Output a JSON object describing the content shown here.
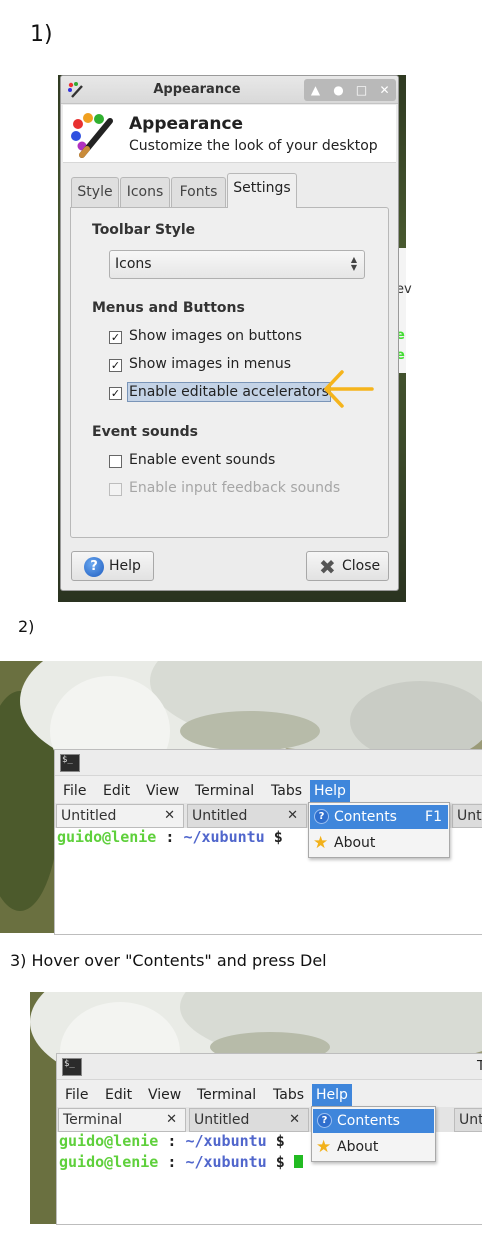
{
  "steps": {
    "one": "1)",
    "two": "2)",
    "three": "3) Hover over \"Contents\" and press Del"
  },
  "appearance": {
    "window_title": "Appearance",
    "header_title": "Appearance",
    "header_subtitle": "Customize the look of your desktop",
    "tabs": [
      "Style",
      "Icons",
      "Fonts",
      "Settings"
    ],
    "active_tab": "Settings",
    "toolbar_style": {
      "heading": "Toolbar Style",
      "value": "Icons"
    },
    "menus_buttons": {
      "heading": "Menus and Buttons",
      "items": [
        {
          "label": "Show images on buttons",
          "checked": true
        },
        {
          "label": "Show images in menus",
          "checked": true
        },
        {
          "label": "Enable editable accelerators",
          "checked": true
        }
      ]
    },
    "event_sounds": {
      "heading": "Event sounds",
      "items": [
        {
          "label": "Enable event sounds",
          "checked": false
        },
        {
          "label": "Enable input feedback sounds",
          "checked": false,
          "disabled": true
        }
      ]
    },
    "help_button": "Help",
    "close_button": "Close",
    "background_fragments": {
      "side_text": "ev",
      "green_1": "e",
      "green_2": "e"
    },
    "arrow_color": "#f5b41c"
  },
  "terminal_2": {
    "menus": [
      "File",
      "Edit",
      "View",
      "Terminal",
      "Tabs",
      "Help"
    ],
    "open_menu": "Help",
    "tabs": [
      "Untitled",
      "Untitled",
      "Unt"
    ],
    "tab_close": "✕",
    "prompt": {
      "user": "guido@lenie",
      "sep": " : ",
      "path": "~/xubuntu",
      "dollar": " $"
    },
    "dropdown": [
      {
        "label": "Contents",
        "accel": "F1",
        "icon": "help-icon",
        "highlighted": true
      },
      {
        "label": "About",
        "accel": "",
        "icon": "star-icon",
        "highlighted": false
      }
    ]
  },
  "terminal_3": {
    "title_fragment": "T",
    "menus": [
      "File",
      "Edit",
      "View",
      "Terminal",
      "Tabs",
      "Help"
    ],
    "open_menu": "Help",
    "tabs": [
      "Terminal",
      "Untitled",
      "Unt"
    ],
    "tab_close": "✕",
    "prompt": {
      "user": "guido@lenie",
      "sep": " : ",
      "path": "~/xubuntu",
      "dollar": " $"
    },
    "dropdown": [
      {
        "label": "Contents",
        "accel": "",
        "icon": "help-icon",
        "highlighted": true
      },
      {
        "label": "About",
        "accel": "",
        "icon": "star-icon",
        "highlighted": false
      }
    ]
  },
  "colors": {
    "menu_highlight": "#3f86db",
    "prompt_user": "#5fd03c",
    "prompt_path": "#5066cc",
    "cursor": "#22bb22"
  }
}
